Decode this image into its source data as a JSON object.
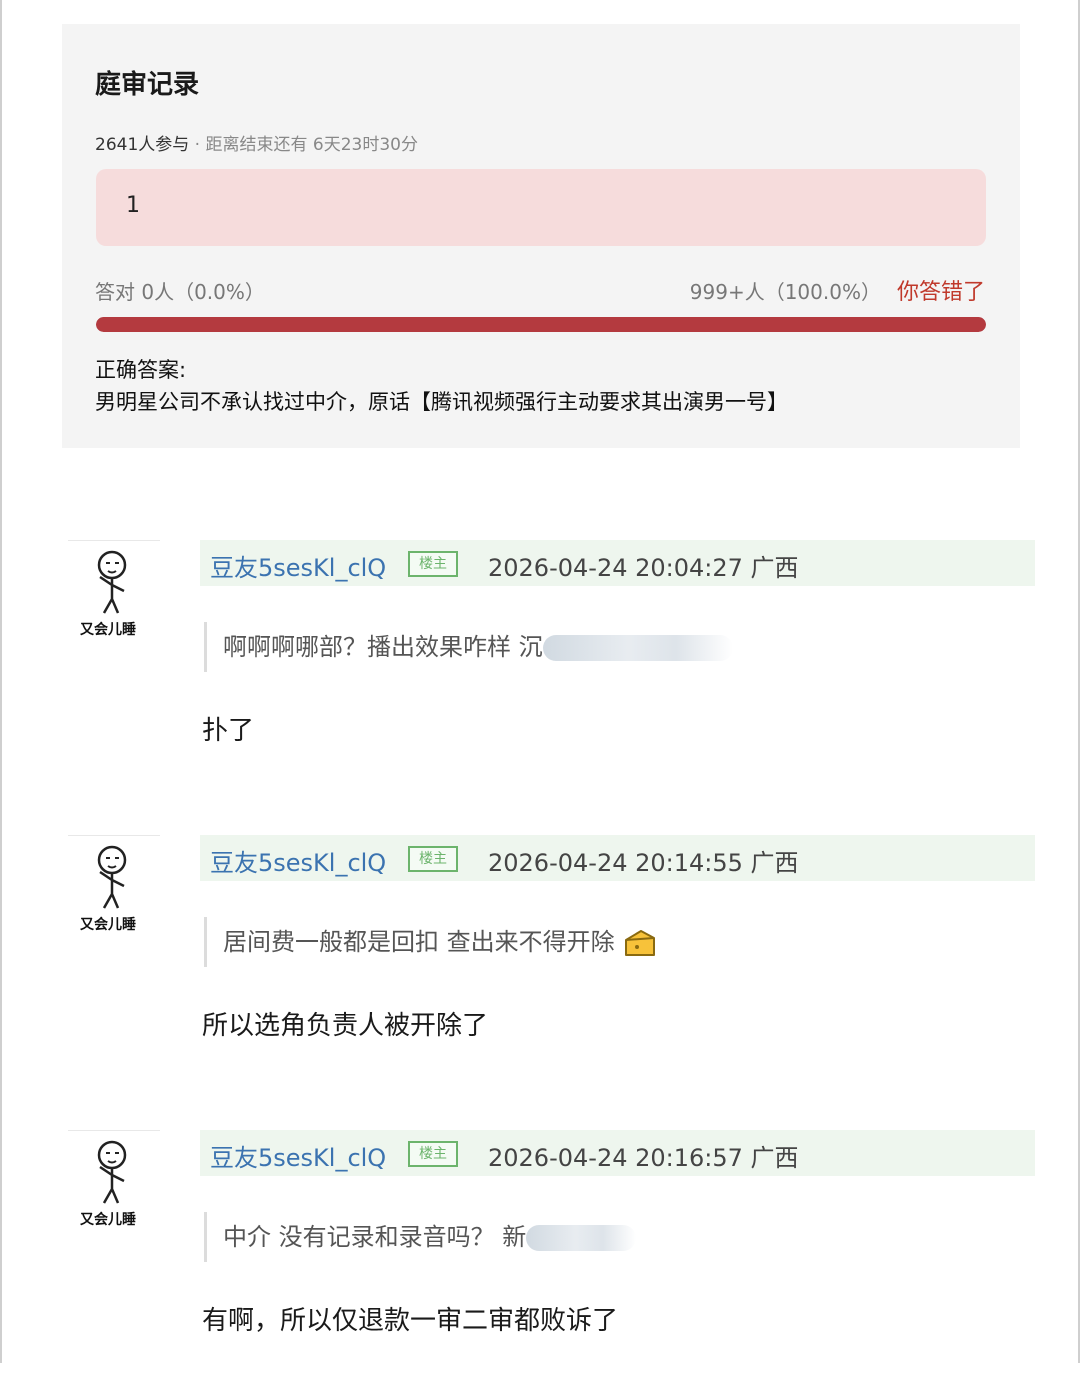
{
  "poll": {
    "title": "庭审记录",
    "participants": "2641人参与",
    "separator": " · ",
    "countdown": "距离结束还有 6天23时30分",
    "option_label": "1",
    "correct_stat": "答对  0人（0.0%）",
    "chosen_stat": "999+人（100.0%）",
    "wrong_text": "你答错了",
    "bar_fill_percent": 100,
    "answer_label": "正确答案:",
    "answer_text": "男明星公司不承认找过中介，原话【腾讯视频强行主动要求其出演男一号】",
    "colors": {
      "option_bg": "#f6dcdc",
      "bar": "#b43a3f",
      "wrong": "#c0392b"
    }
  },
  "comments": [
    {
      "avatar_caption": "又会儿睡",
      "user": "豆友5sesKl_clQ",
      "badge": "楼主",
      "time": "2026-04-24 20:04:27 广西",
      "quote": "啊啊啊哪部？播出效果咋样 沉",
      "reply": "扑了"
    },
    {
      "avatar_caption": "又会儿睡",
      "user": "豆友5sesKl_clQ",
      "badge": "楼主",
      "time": "2026-04-24 20:14:55 广西",
      "quote": "居间费一般都是回扣 查出来不得开除",
      "quote_icon": "cheese-emoji-icon",
      "reply": "所以选角负责人被开除了"
    },
    {
      "avatar_caption": "又会儿睡",
      "user": "豆友5sesKl_clQ",
      "badge": "楼主",
      "time": "2026-04-24 20:16:57 广西",
      "quote": "中介 没有记录和录音吗？ 新",
      "reply": "有啊，所以仅退款一审二审都败诉了"
    }
  ]
}
